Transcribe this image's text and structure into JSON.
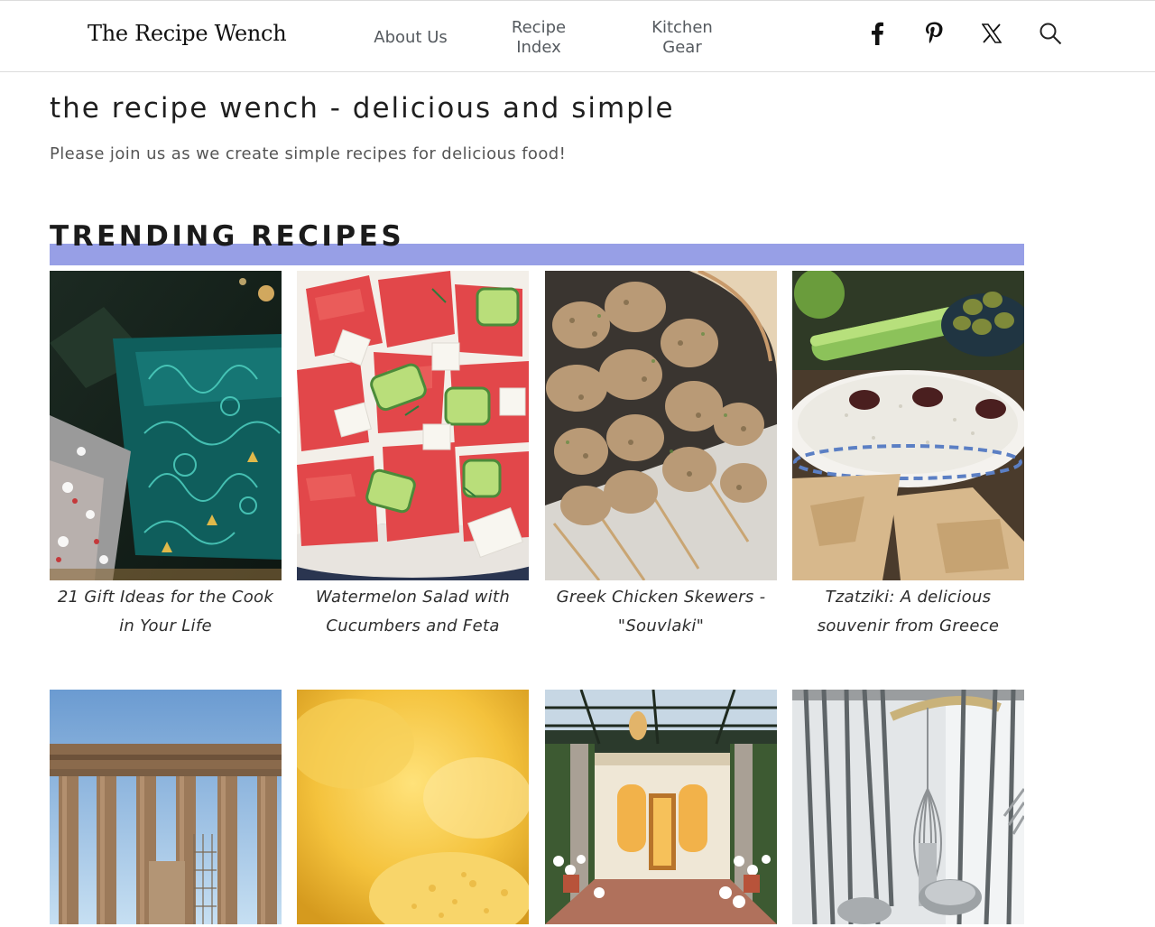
{
  "header": {
    "logo": "The Recipe Wench",
    "nav": [
      {
        "lines": [
          "About Us"
        ]
      },
      {
        "lines": [
          "Recipe",
          "Index"
        ]
      },
      {
        "lines": [
          "Kitchen",
          "Gear"
        ]
      }
    ],
    "icons": [
      "facebook-icon",
      "pinterest-icon",
      "x-icon",
      "search-icon"
    ]
  },
  "intro": {
    "title": "the recipe wench - delicious and simple",
    "text": "Please join us as we create simple recipes for delicious food!"
  },
  "trending": {
    "heading": "TRENDING RECIPES",
    "accent_color": "#979fe6",
    "cards": [
      {
        "caption": "21 Gift Ideas for the Cook in Your Life"
      },
      {
        "caption": "Watermelon Salad with Cucumbers and Feta"
      },
      {
        "caption": "Greek Chicken Skewers - \"Souvlaki\""
      },
      {
        "caption": "Tzatziki: A delicious souvenir from Greece"
      },
      {
        "caption": ""
      },
      {
        "caption": ""
      },
      {
        "caption": ""
      },
      {
        "caption": ""
      }
    ]
  }
}
